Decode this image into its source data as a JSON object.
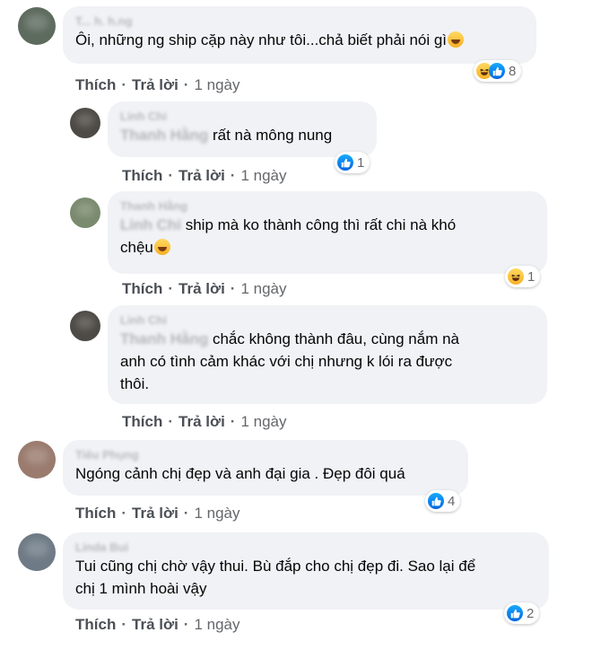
{
  "actions": {
    "like": "Thích",
    "reply": "Trả lời",
    "sep": "·",
    "time": "1 ngày"
  },
  "comments": [
    {
      "author": "T... h. h.ng",
      "text": "Ôi, những ng ship cặp này như tôi...chả biết phải nói gì",
      "reactions": {
        "icons": [
          "haha-icon",
          "like-icon"
        ],
        "count": "8"
      }
    },
    {
      "author": "Linh Chi",
      "mention": "Thanh Hằng",
      "text": "rất nà mông nung",
      "reactions": {
        "icons": [
          "like-icon"
        ],
        "count": "1"
      }
    },
    {
      "author": "Thanh Hằng",
      "mention": "Linh Chi",
      "text": "ship mà ko thành công thì rất chi nà khó",
      "text2": "chệu",
      "reactions": {
        "icons": [
          "haha-icon"
        ],
        "count": "1"
      }
    },
    {
      "author": "Linh Chi",
      "mention": "Thanh Hằng",
      "text": "chắc không thành đâu, cùng nắm nà",
      "text2": "anh có tình cảm khác với chị nhưng k lói ra được",
      "text3": "thôi."
    },
    {
      "author": "Tiêu Phụng",
      "text": "Ngóng cảnh chị đẹp và anh đại gia . Đẹp đôi quá",
      "reactions": {
        "icons": [
          "like-icon"
        ],
        "count": "4"
      }
    },
    {
      "author": "Linda Bui",
      "text": "Tui cũng chị chờ vậy thui. Bù đắp cho chị đẹp đi. Sao lại để",
      "text2": "chị 1 mình hoài vậy",
      "reactions": {
        "icons": [
          "like-icon"
        ],
        "count": "2"
      }
    }
  ]
}
